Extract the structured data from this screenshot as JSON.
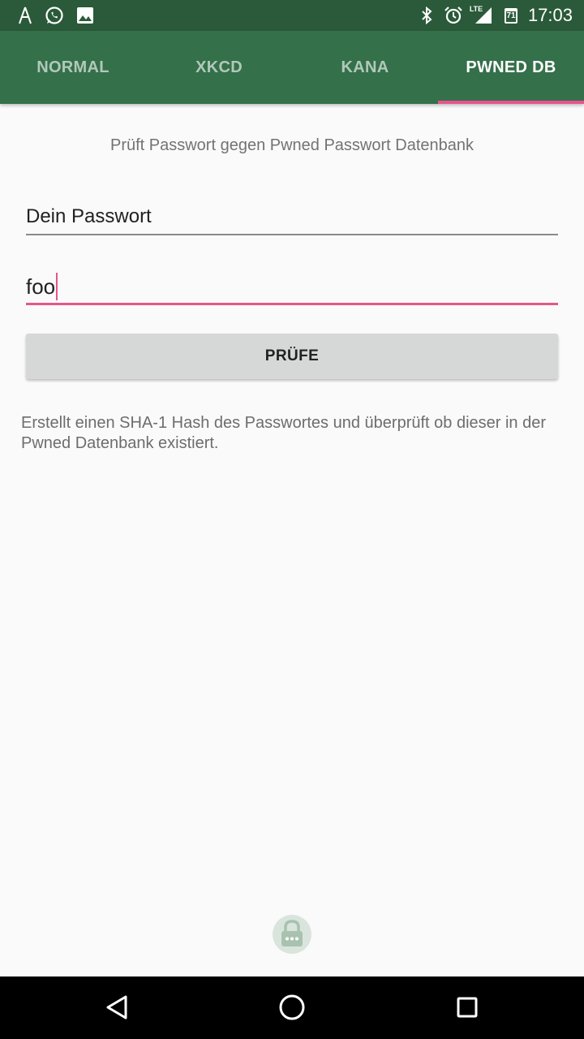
{
  "status_bar": {
    "time": "17:03",
    "network_label": "LTE",
    "calendar_day": "71",
    "left_icons": [
      "antenna-icon",
      "whatsapp-icon",
      "image-icon"
    ],
    "right_icons": [
      "bluetooth-icon",
      "alarm-icon",
      "signal-icon",
      "calendar-icon"
    ]
  },
  "tabs": [
    {
      "label": "NORMAL",
      "active": false
    },
    {
      "label": "XKCD",
      "active": false
    },
    {
      "label": "KANA",
      "active": false
    },
    {
      "label": "PWNED DB",
      "active": true
    }
  ],
  "main": {
    "subtitle": "Prüft Passwort gegen Pwned Passwort Datenbank",
    "field_label": "Dein Passwort",
    "password_value": "foo",
    "check_button_label": "PRÜFE",
    "description": "Erstellt einen SHA-1 Hash des Passwortes und überprüft ob dieser in der Pwned Datenbank existiert."
  },
  "colors": {
    "status_bar": "#2a5a39",
    "toolbar": "#34704a",
    "accent": "#e8558a",
    "button": "#d6d7d7"
  },
  "nav_bar": {
    "buttons": [
      "back-icon",
      "home-icon",
      "recents-icon"
    ]
  }
}
